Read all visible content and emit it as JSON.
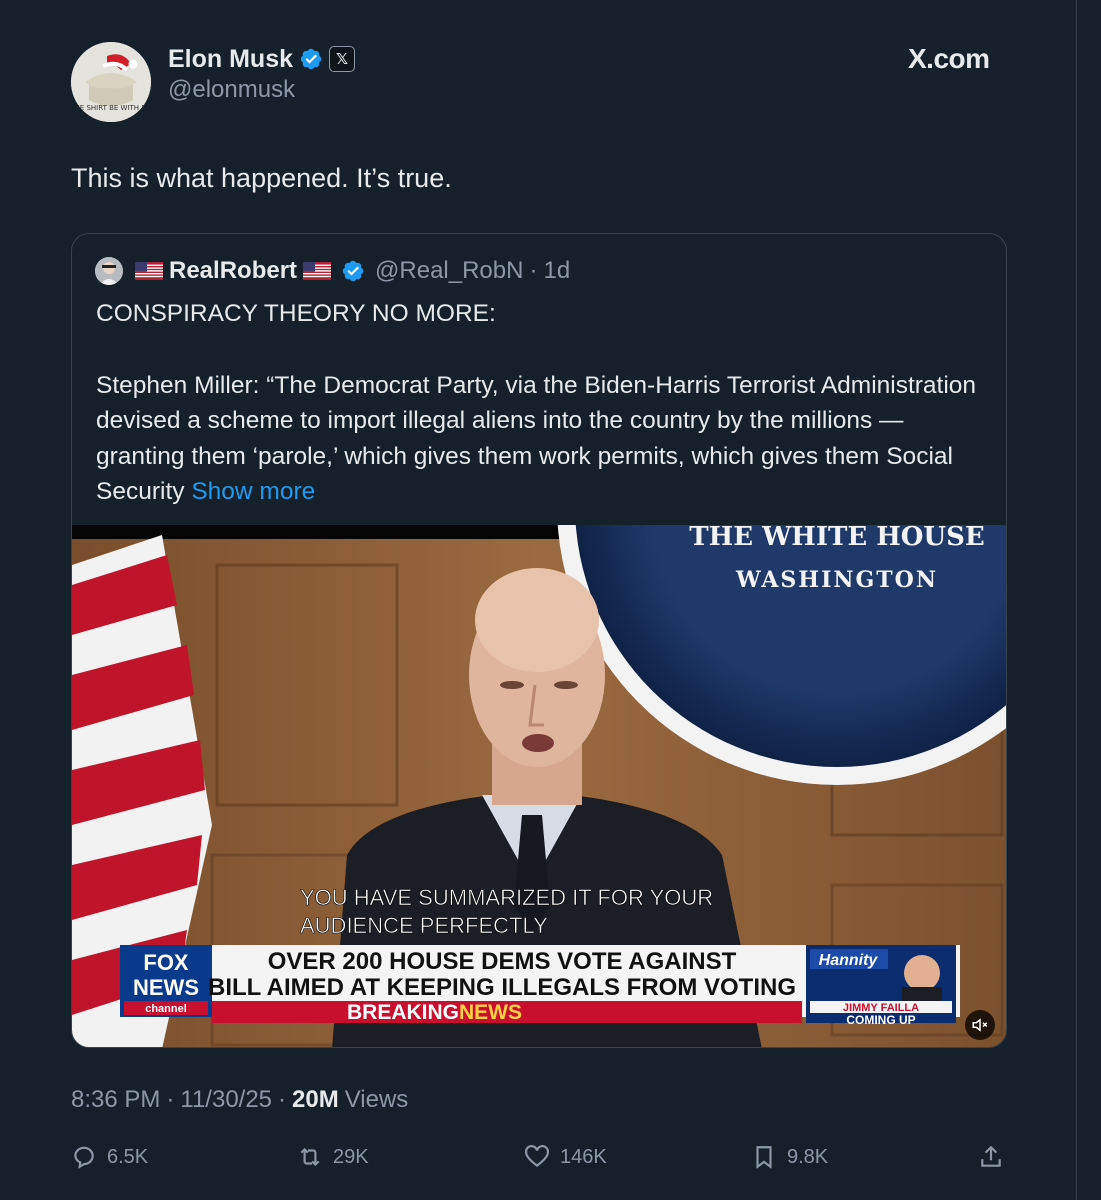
{
  "author": {
    "display_name": "Elon Musk",
    "handle": "@elonmusk",
    "affiliation_badge": "𝕏",
    "avatar_caption": "THE SHIRT BE WITH ME"
  },
  "brand": "X.com",
  "tweet": {
    "text": "This is what happened. It’s true."
  },
  "quoted": {
    "display_name": "RealRobert",
    "handle": "@Real_RobN",
    "separator": "·",
    "age": "1d",
    "line1": "CONSPIRACY THEORY NO MORE:",
    "body": "Stephen Miller: “The Democrat Party, via the Biden-Harris Terrorist Administration devised a scheme to import illegal aliens into the country by the millions — granting them ‘parole,’ which gives them work permits, which gives them Social Security",
    "show_more": "Show more",
    "video": {
      "seal_text": "WASHINGTON",
      "seal_top_text": "THE WHITE HOUSE",
      "caption_line1": "YOU HAVE SUMMARIZED IT FOR YOUR",
      "caption_line2": "AUDIENCE PERFECTLY",
      "network_top": "FOX",
      "network_mid": "NEWS",
      "network_bottom": "channel",
      "headline_line1": "OVER 200 HOUSE DEMS VOTE AGAINST",
      "headline_line2": "BILL AIMED AT KEEPING ILLEGALS FROM VOTING",
      "breaking_a": "BREAKING ",
      "breaking_b": "NEWS",
      "show_name": "Hannity",
      "guest_name": "JIMMY FAILLA",
      "coming_up": "COMING UP"
    }
  },
  "meta": {
    "time": "8:36 PM",
    "sep1": "·",
    "date": "11/30/25",
    "sep2": "·",
    "views_count": "20M",
    "views_label": "Views"
  },
  "actions": {
    "replies": "6.5K",
    "reposts": "29K",
    "likes": "146K",
    "bookmarks": "9.8K"
  },
  "colors": {
    "background": "#15202b",
    "text": "#e7e9ea",
    "muted": "#8b98a5",
    "link": "#1d9bf0",
    "verified": "#1d9bf0",
    "fox_red": "#c8102e"
  }
}
